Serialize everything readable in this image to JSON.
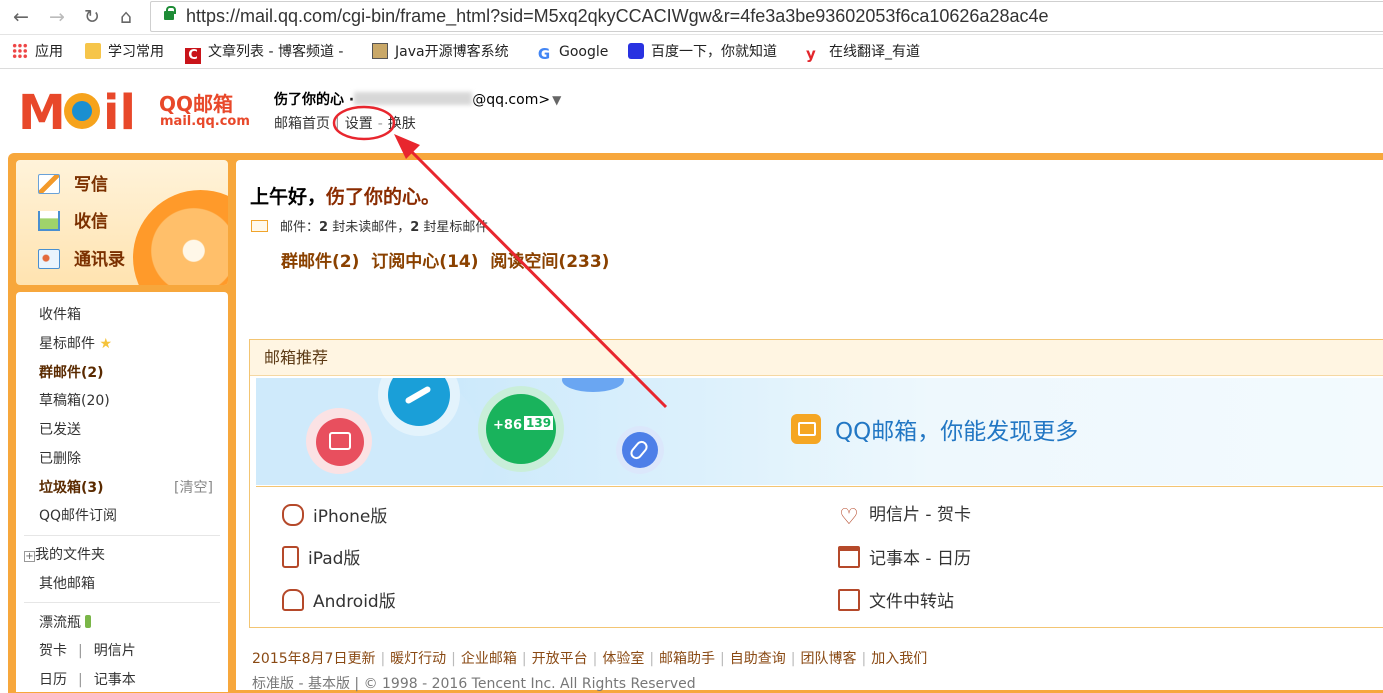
{
  "browser": {
    "url": "https://mail.qq.com/cgi-bin/frame_html?sid=M5xq2qkyCCACIWgw&r=4fe3a3be93602053f6ca10626a28ac4e",
    "bookmarks": [
      "应用",
      "学习常用",
      "文章列表 - 博客频道 -",
      "Java开源博客系统",
      "Google",
      "百度一下，你就知道",
      "在线翻译_有道"
    ]
  },
  "header": {
    "logo_main": "QQ邮箱",
    "logo_sub": "mail.qq.com",
    "nickname": "伤了你的心 ·",
    "email_suffix": "@qq.com>",
    "links": [
      "邮箱首页",
      "设置",
      "换肤"
    ]
  },
  "actions": [
    "写信",
    "收信",
    "通讯录"
  ],
  "folders": {
    "inbox": "收件箱",
    "starred": "星标邮件",
    "group": "群邮件(2)",
    "drafts": "草稿箱(20)",
    "sent": "已发送",
    "deleted": "已删除",
    "spam": "垃圾箱(3)",
    "clear": "[清空]",
    "subscription": "QQ邮件订阅",
    "my_folders": "我的文件夹",
    "other_mailboxes": "其他邮箱",
    "drift_bottle": "漂流瓶",
    "card": "贺卡",
    "postcard": "明信片",
    "calendar": "日历",
    "notebook": "记事本"
  },
  "welcome": {
    "greeting": "上午好，",
    "name": "伤了你的心。",
    "mail_label": "邮件：",
    "unread_count": "2",
    "unread_text": "封未读邮件，",
    "star_count": "2",
    "star_text": "封星标邮件",
    "quick_links": [
      "群邮件(2)",
      "订阅中心(14)",
      "阅读空间(233)"
    ]
  },
  "recommend": {
    "title": "邮箱推荐",
    "banner_text": "QQ邮箱，你能发现更多",
    "phone_prefix": "+86",
    "phone_number": "139",
    "versions_left": [
      "iPhone版",
      "iPad版",
      "Android版"
    ],
    "versions_right": [
      "明信片 - 贺卡",
      "记事本 - 日历",
      "文件中转站"
    ]
  },
  "footer": {
    "links": [
      "2015年8月7日更新",
      "暖灯行动",
      "企业邮箱",
      "开放平台",
      "体验室",
      "邮箱助手",
      "自助查询",
      "团队博客",
      "加入我们"
    ],
    "copyright": "标准版 - 基本版 | © 1998 - 2016 Tencent Inc. All Rights Reserved"
  },
  "colors": {
    "accent": "#f7a73c",
    "link_brown": "#8a4100",
    "banner_blue": "#2277c4",
    "annotation_red": "#e8262e"
  }
}
